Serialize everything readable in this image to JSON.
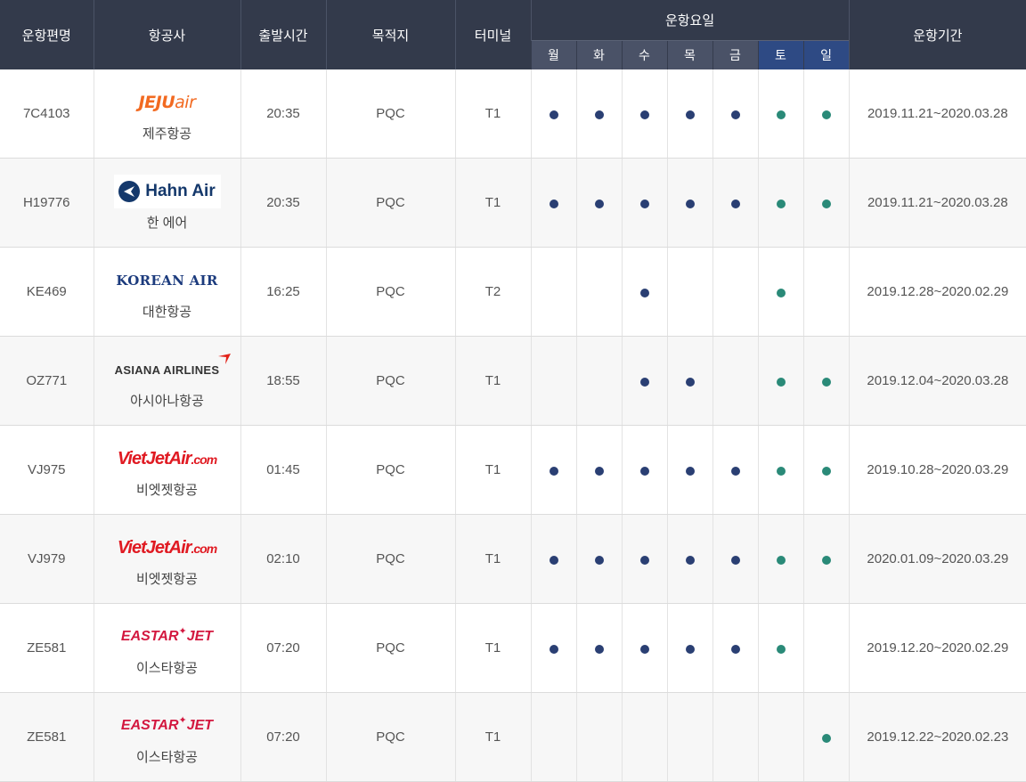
{
  "header": {
    "flight": "운항편명",
    "airline": "항공사",
    "departure": "출발시간",
    "destination": "목적지",
    "terminal": "터미널",
    "days_group": "운항요일",
    "period": "운항기간",
    "days": [
      "월",
      "화",
      "수",
      "목",
      "금",
      "토",
      "일"
    ]
  },
  "logos": {
    "jeju": {
      "main": "JEJU",
      "sub": "air"
    },
    "hahn": "Hahn Air",
    "korean": "KOREAN AIR",
    "asiana": "ASIANA AIRLINES",
    "vietjet": {
      "main": "VietJetAir",
      "sub": ".com"
    },
    "eastar": {
      "left": "EASTAR",
      "star": "✦",
      "right": "JET"
    }
  },
  "colors": {
    "header_bg": "#333a4b",
    "subheader_bg": "#4a5267",
    "weekend_header_bg": "#2e4a84",
    "dot_weekday": "#2a3f73",
    "dot_weekend": "#2a8a78"
  },
  "rows": [
    {
      "flight": "7C4103",
      "logo": "jeju",
      "airline": "제주항공",
      "time": "20:35",
      "dest": "PQC",
      "terminal": "T1",
      "days": [
        1,
        1,
        1,
        1,
        1,
        1,
        1
      ],
      "period": "2019.11.21~2020.03.28"
    },
    {
      "flight": "H19776",
      "logo": "hahn",
      "airline": "한 에어",
      "time": "20:35",
      "dest": "PQC",
      "terminal": "T1",
      "days": [
        1,
        1,
        1,
        1,
        1,
        1,
        1
      ],
      "period": "2019.11.21~2020.03.28"
    },
    {
      "flight": "KE469",
      "logo": "korean",
      "airline": "대한항공",
      "time": "16:25",
      "dest": "PQC",
      "terminal": "T2",
      "days": [
        0,
        0,
        1,
        0,
        0,
        1,
        0
      ],
      "period": "2019.12.28~2020.02.29"
    },
    {
      "flight": "OZ771",
      "logo": "asiana",
      "airline": "아시아나항공",
      "time": "18:55",
      "dest": "PQC",
      "terminal": "T1",
      "days": [
        0,
        0,
        1,
        1,
        0,
        1,
        1
      ],
      "period": "2019.12.04~2020.03.28"
    },
    {
      "flight": "VJ975",
      "logo": "vietjet",
      "airline": "비엣젯항공",
      "time": "01:45",
      "dest": "PQC",
      "terminal": "T1",
      "days": [
        1,
        1,
        1,
        1,
        1,
        1,
        1
      ],
      "period": "2019.10.28~2020.03.29"
    },
    {
      "flight": "VJ979",
      "logo": "vietjet",
      "airline": "비엣젯항공",
      "time": "02:10",
      "dest": "PQC",
      "terminal": "T1",
      "days": [
        1,
        1,
        1,
        1,
        1,
        1,
        1
      ],
      "period": "2020.01.09~2020.03.29"
    },
    {
      "flight": "ZE581",
      "logo": "eastar",
      "airline": "이스타항공",
      "time": "07:20",
      "dest": "PQC",
      "terminal": "T1",
      "days": [
        1,
        1,
        1,
        1,
        1,
        1,
        0
      ],
      "period": "2019.12.20~2020.02.29"
    },
    {
      "flight": "ZE581",
      "logo": "eastar",
      "airline": "이스타항공",
      "time": "07:20",
      "dest": "PQC",
      "terminal": "T1",
      "days": [
        0,
        0,
        0,
        0,
        0,
        0,
        1
      ],
      "period": "2019.12.22~2020.02.23"
    }
  ]
}
